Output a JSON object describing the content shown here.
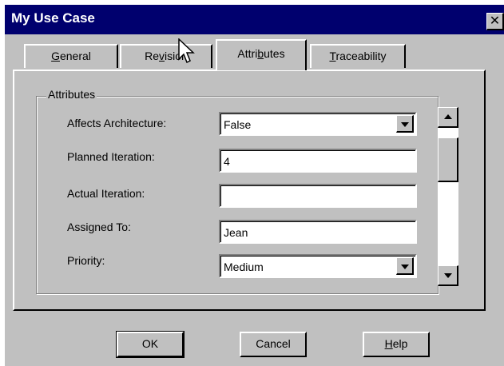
{
  "window": {
    "title": "My Use Case",
    "close_glyph": "✕"
  },
  "tabs": [
    {
      "pre": "",
      "ul": "G",
      "post": "eneral"
    },
    {
      "pre": "Re",
      "ul": "v",
      "post": "ision"
    },
    {
      "pre": "Attri",
      "ul": "b",
      "post": "utes"
    },
    {
      "pre": "",
      "ul": "T",
      "post": "raceability"
    }
  ],
  "active_tab": "Attributes",
  "group": {
    "title": "Attributes"
  },
  "fields": {
    "affects_architecture": {
      "label": "Affects Architecture:",
      "value": "False",
      "type": "dropdown"
    },
    "planned_iteration": {
      "label": "Planned Iteration:",
      "value": "4",
      "type": "text"
    },
    "actual_iteration": {
      "label": "Actual Iteration:",
      "value": "",
      "type": "text"
    },
    "assigned_to": {
      "label": "Assigned To:",
      "value": "Jean",
      "type": "text"
    },
    "priority": {
      "label": "Priority:",
      "value": "Medium",
      "type": "dropdown"
    }
  },
  "buttons": {
    "ok": "OK",
    "cancel": "Cancel",
    "help_ul": "H",
    "help_rest": "elp"
  },
  "colors": {
    "titlebar": "#00006e",
    "face": "#c0c0c0"
  }
}
